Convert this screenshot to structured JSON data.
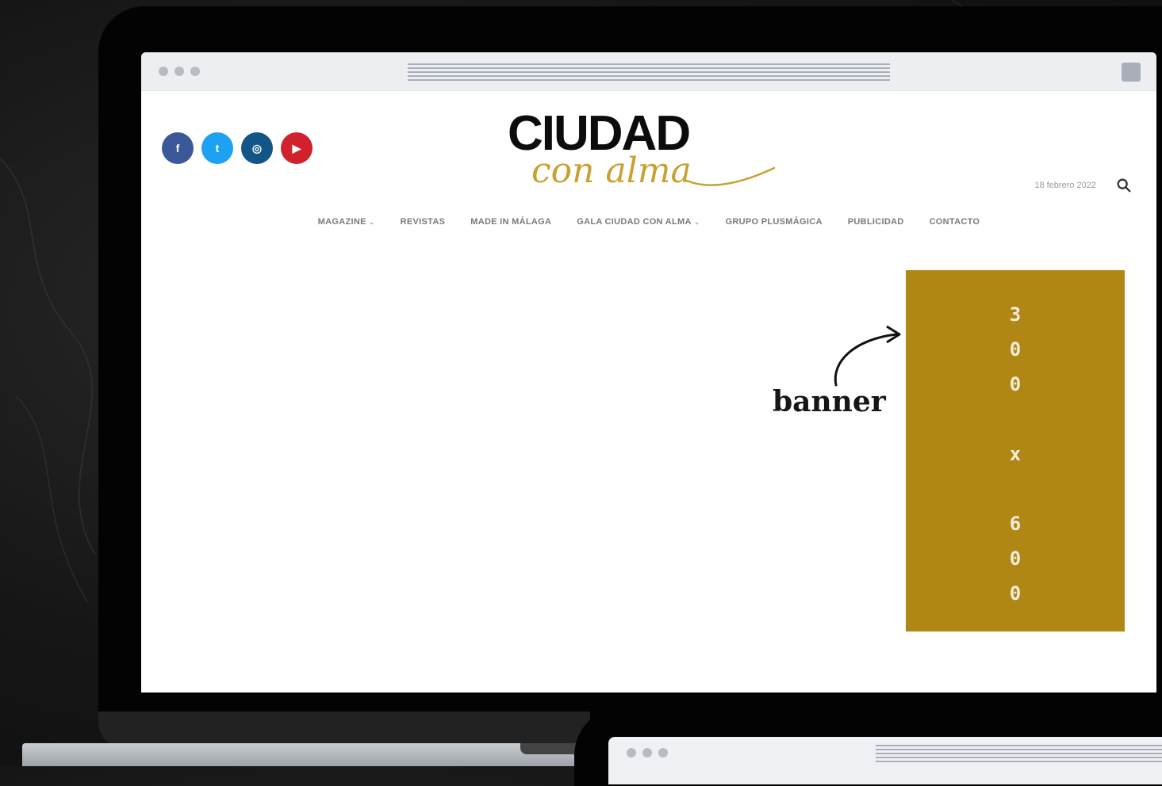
{
  "site": {
    "logo_main": "CIUDAD",
    "logo_script": "con alma",
    "date": "18 febrero 2022"
  },
  "socials": [
    {
      "label": "f",
      "icon": "facebook-icon",
      "color": "#3b5998"
    },
    {
      "label": "t",
      "icon": "twitter-icon",
      "color": "#1da1f2"
    },
    {
      "label": "◎",
      "icon": "instagram-icon",
      "color": "#125688"
    },
    {
      "label": "▶",
      "icon": "youtube-icon",
      "color": "#d0212c"
    }
  ],
  "nav": [
    {
      "label": "MAGAZINE",
      "has_caret": true
    },
    {
      "label": "REVISTAS",
      "has_caret": false
    },
    {
      "label": "MADE IN MÁLAGA",
      "has_caret": false
    },
    {
      "label": "GALA CIUDAD CON ALMA",
      "has_caret": true
    },
    {
      "label": "GRUPO PLUSMÁGICA",
      "has_caret": false
    },
    {
      "label": "PUBLICIDAD",
      "has_caret": false
    },
    {
      "label": "CONTACTO",
      "has_caret": false
    }
  ],
  "banner": {
    "label": "banner",
    "size_text": "300x600",
    "color": "#b08614"
  },
  "colors": {
    "accent_gold": "#c9a132",
    "text_dark": "#0c0c0c"
  }
}
